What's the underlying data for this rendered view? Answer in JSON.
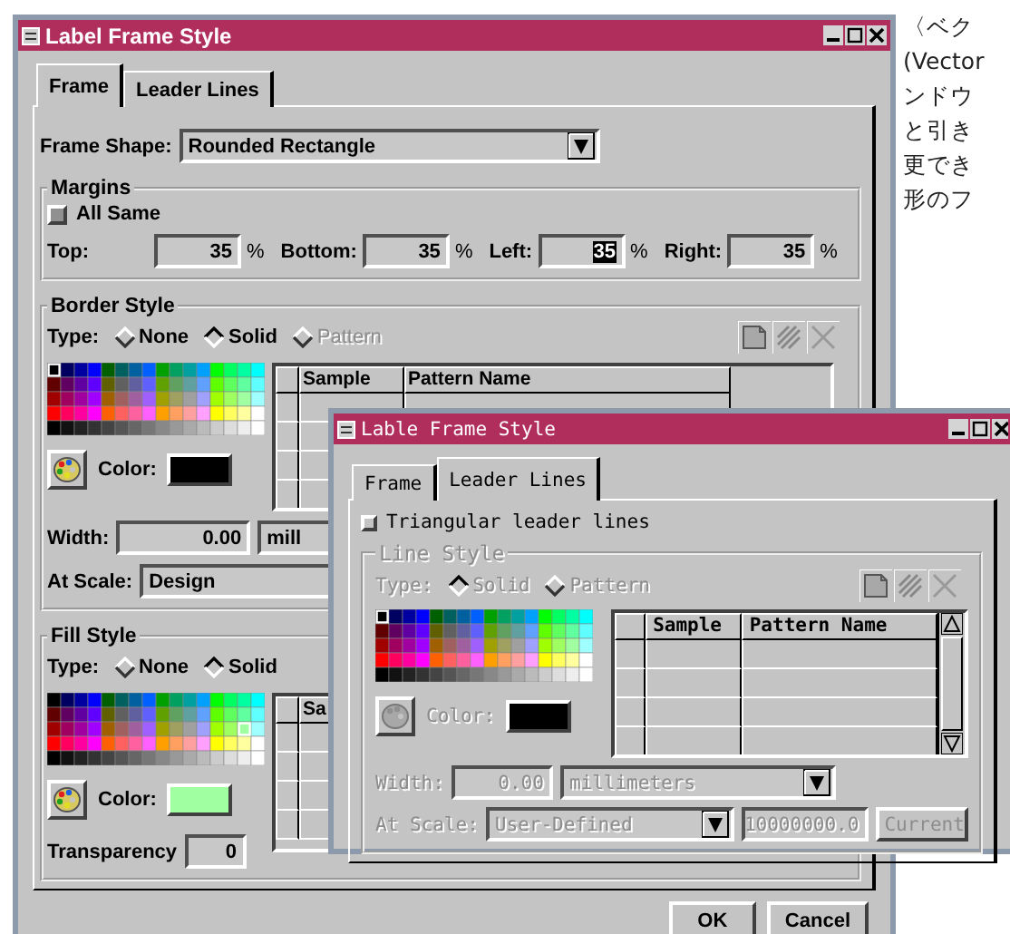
{
  "main_dialog": {
    "title": "Label Frame Style",
    "tabs": [
      {
        "label": "Frame",
        "selected": true
      },
      {
        "label": "Leader Lines",
        "selected": false
      }
    ],
    "frame_shape": {
      "label": "Frame Shape:",
      "value": "Rounded Rectangle"
    },
    "margins": {
      "title": "Margins",
      "all_same": {
        "label": "All Same",
        "checked": false
      },
      "fields": [
        {
          "label": "Top:",
          "value": "35",
          "unit": "%",
          "highlighted": false
        },
        {
          "label": "Bottom:",
          "value": "35",
          "unit": "%",
          "highlighted": false
        },
        {
          "label": "Left:",
          "value": "35",
          "unit": "%",
          "highlighted": true
        },
        {
          "label": "Right:",
          "value": "35",
          "unit": "%",
          "highlighted": false
        }
      ]
    },
    "border_style": {
      "title": "Border Style",
      "type_label": "Type:",
      "types": [
        {
          "label": "None",
          "selected": false,
          "disabled": false
        },
        {
          "label": "Solid",
          "selected": true,
          "disabled": false
        },
        {
          "label": "Pattern",
          "selected": false,
          "disabled": true
        }
      ],
      "table_columns": [
        "Sample",
        "Pattern Name"
      ],
      "color": {
        "label": "Color:",
        "color": "#000000"
      },
      "width": {
        "label": "Width:",
        "value": "0.00",
        "unit": "mill"
      },
      "at_scale": {
        "label": "At Scale:",
        "value": "Design"
      }
    },
    "fill_style": {
      "title": "Fill Style",
      "type_label": "Type:",
      "types": [
        {
          "label": "None",
          "selected": false,
          "disabled": false
        },
        {
          "label": "Solid",
          "selected": true,
          "disabled": false
        }
      ],
      "table_columns": [
        "Sa"
      ],
      "color": {
        "label": "Color:",
        "color": "#a0ffa0"
      },
      "transparency": {
        "label": "Transparency",
        "value": "0"
      }
    },
    "buttons": [
      "OK",
      "Cancel"
    ]
  },
  "front_dialog": {
    "title": "Lable Frame Style",
    "tabs": [
      {
        "label": "Frame",
        "selected": false
      },
      {
        "label": "Leader Lines",
        "selected": true
      }
    ],
    "triangular": {
      "label": "Triangular leader lines",
      "checked": false
    },
    "line_style": {
      "title": "Line Style",
      "disabled": true,
      "type_label": "Type:",
      "types": [
        {
          "label": "Solid",
          "selected": true
        },
        {
          "label": "Pattern",
          "selected": false
        }
      ],
      "table_columns": [
        "Sample",
        "Pattern Name"
      ],
      "color": {
        "label": "Color:",
        "color": "#000000"
      },
      "width": {
        "label": "Width:",
        "value": "0.00",
        "unit": "millimeters"
      },
      "at_scale": {
        "label": "At Scale:",
        "value": "User-Defined",
        "scale": "10000000.0",
        "button": "Current"
      }
    }
  },
  "caption_lines": [
    "〈ベク",
    "(Vector",
    "ンドウ",
    "と引き",
    "更でき",
    "形のフ"
  ]
}
